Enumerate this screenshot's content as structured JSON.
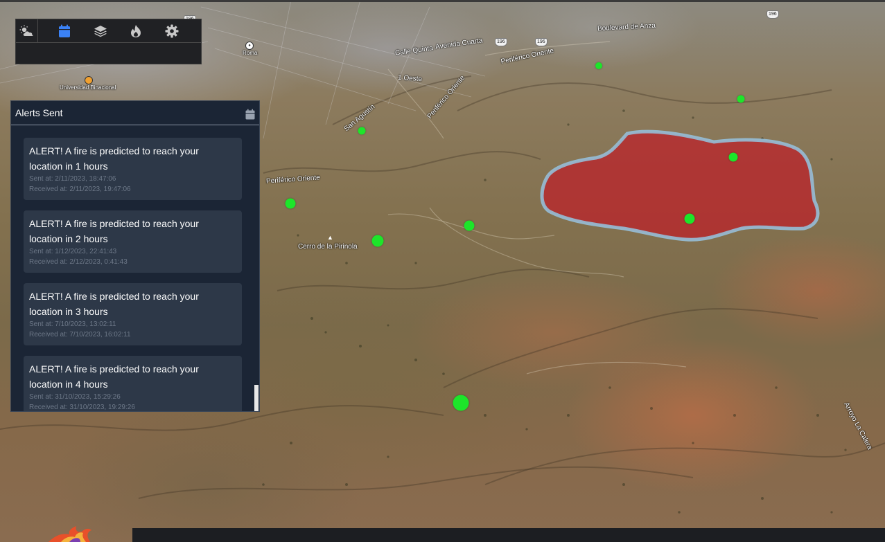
{
  "toolbar": {
    "buttons": [
      {
        "id": "weather",
        "icon": "cloud-sun-icon",
        "color": "#c8c8c8"
      },
      {
        "id": "alerts",
        "icon": "calendar-icon",
        "color": "#3b82f6",
        "active": true
      },
      {
        "id": "layers",
        "icon": "layers-icon",
        "color": "#c8c8c8"
      },
      {
        "id": "fire",
        "icon": "fire-icon",
        "color": "#c8c8c8"
      },
      {
        "id": "settings",
        "icon": "gear-icon",
        "color": "#c8c8c8"
      }
    ]
  },
  "alerts_panel": {
    "title": "Alerts Sent",
    "header_icon": "calendar-icon",
    "items": [
      {
        "message": "ALERT! A fire is predicted to reach your location in 1 hours",
        "sent": "Sent at: 2/11/2023, 18:47:06",
        "received": "Received at: 2/11/2023, 19:47:06"
      },
      {
        "message": "ALERT! A fire is predicted to reach your location in 2 hours",
        "sent": "Sent at: 1/12/2023, 22:41:43",
        "received": "Received at: 2/12/2023, 0:41:43"
      },
      {
        "message": "ALERT! A fire is predicted to reach your location in 3 hours",
        "sent": "Sent at: 7/10/2023, 13:02:11",
        "received": "Received at: 7/10/2023, 16:02:11"
      },
      {
        "message": "ALERT! A fire is predicted to reach your location in 4 hours",
        "sent": "Sent at: 31/10/2023, 15:29:26",
        "received": "Received at: 31/10/2023, 19:29:26"
      }
    ]
  },
  "map": {
    "labels": {
      "boulevard_de_anza": "Boulevard de Anza",
      "calle_quinta": "Calle Quinta",
      "avenida_cuarta": "Avenida Cuarta",
      "periferico_oriente_1": "Periférico Oriente",
      "periferico_oriente_2": "Periférico Oriente",
      "periferico_oriente_3": "Periférico Oriente",
      "oeste": "1 Oeste",
      "san_agustin": "San Agustín",
      "roma": "Roma",
      "universidad": "Universidad Binacional",
      "cerro": "Cerro de la Pirinola",
      "arroyo": "Arroyo La Calera"
    },
    "shields": {
      "s1": "196",
      "s2": "196",
      "s3": "196",
      "s4": "196"
    },
    "fire_zone_color": "#c0282f",
    "marker_color": "#1de52a"
  }
}
